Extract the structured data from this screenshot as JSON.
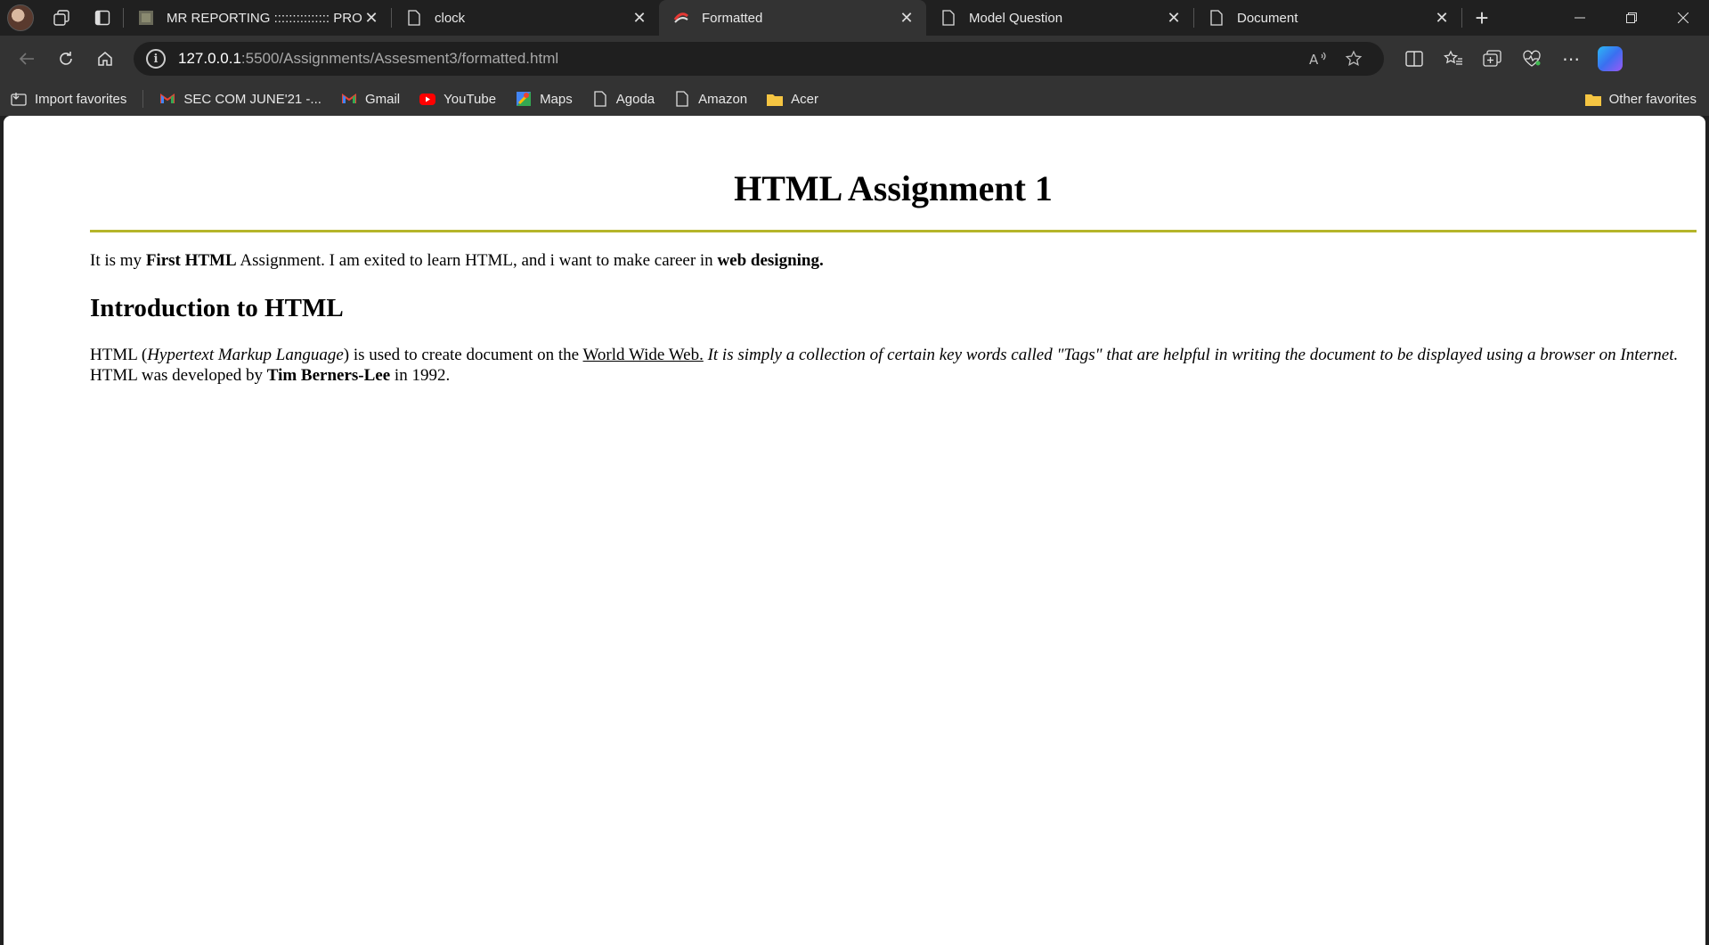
{
  "browser": {
    "tabs": [
      {
        "title": "MR REPORTING ::::::::::::::: PROCE",
        "favicon": "generic-site-icon",
        "active": false
      },
      {
        "title": "clock",
        "favicon": "page-icon",
        "active": false
      },
      {
        "title": "Formatted",
        "favicon": "live-server-icon",
        "active": true
      },
      {
        "title": "Model Question",
        "favicon": "page-icon",
        "active": false
      },
      {
        "title": "Document",
        "favicon": "page-icon",
        "active": false
      }
    ],
    "address": {
      "host": "127.0.0.1",
      "path": ":5500/Assignments/Assesment3/formatted.html"
    },
    "bookmarks": [
      {
        "label": "Import favorites",
        "icon": "import-icon"
      },
      {
        "label": "SEC COM JUNE'21 -...",
        "icon": "gmail-icon"
      },
      {
        "label": "Gmail",
        "icon": "gmail-icon"
      },
      {
        "label": "YouTube",
        "icon": "youtube-icon"
      },
      {
        "label": "Maps",
        "icon": "maps-icon"
      },
      {
        "label": "Agoda",
        "icon": "page-icon"
      },
      {
        "label": "Amazon",
        "icon": "page-icon"
      },
      {
        "label": "Acer",
        "icon": "folder-icon"
      }
    ],
    "other_favorites": "Other favorites"
  },
  "page": {
    "heading": "HTML Assignment 1",
    "rule_color": "#b5b52a",
    "para1": {
      "t1": "It is my ",
      "b1": "First HTML",
      "t2": " Assignment. I am exited to learn HTML, and i want to make career in ",
      "b2": "web designing."
    },
    "subheading": "Introduction to HTML",
    "para2": {
      "t1": "HTML (",
      "i1": "Hypertext Markup Language",
      "t2": ") is used to create document on the ",
      "link": "World Wide Web.",
      "i2": " It is simply a collection of certain key words called \"Tags\" that are helpful in writing the document to be displayed using a browser on Internet.",
      "t3": " HTML was developed by ",
      "b1": "Tim Berners-Lee",
      "t4": " in 1992."
    }
  }
}
